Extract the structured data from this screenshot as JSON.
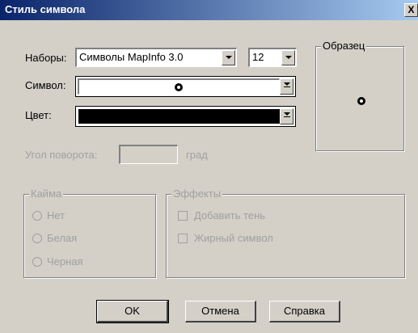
{
  "window": {
    "title": "Стиль символа",
    "close_glyph": "X"
  },
  "sets": {
    "label": "Наборы:",
    "value": "Символы MapInfo 3.0",
    "size_value": "12"
  },
  "symbol": {
    "label": "Символ:"
  },
  "color": {
    "label": "Цвет:",
    "value_hex": "#000000"
  },
  "rotation": {
    "label": "Угол поворота:",
    "value": "",
    "unit": "град"
  },
  "sample": {
    "label": "Образец"
  },
  "border": {
    "label": "Кайма",
    "options": [
      "Нет",
      "Белая",
      "Черная"
    ]
  },
  "effects": {
    "label": "Эффекты",
    "options": [
      "Добавить тень",
      "Жирный символ"
    ]
  },
  "buttons": {
    "ok": "OK",
    "cancel": "Отмена",
    "help": "Справка"
  },
  "icons": {
    "symbol": "filled-circle-icon",
    "dropdown": "chevron-down-icon"
  }
}
